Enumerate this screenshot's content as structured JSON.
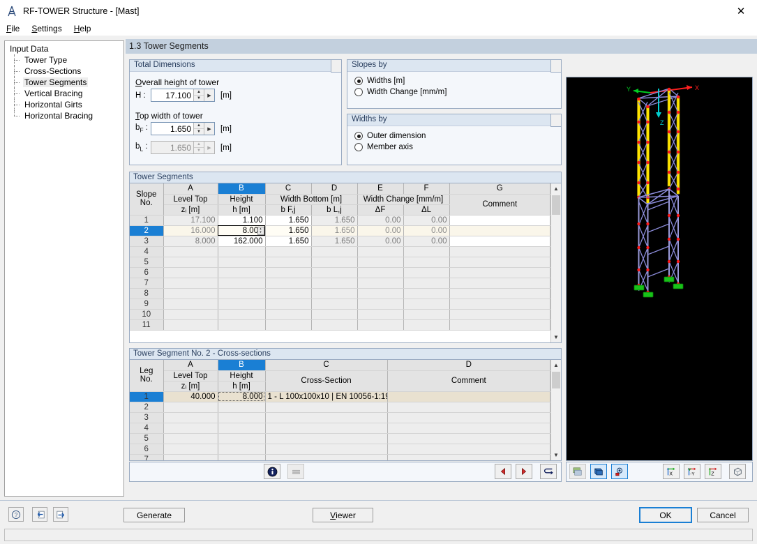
{
  "window": {
    "title": "RF-TOWER Structure - [Mast]",
    "app_icon": "tower-icon",
    "close_label": "✕"
  },
  "menu": [
    {
      "label": "File",
      "accel": "F"
    },
    {
      "label": "Settings",
      "accel": "S"
    },
    {
      "label": "Help",
      "accel": "H"
    }
  ],
  "sidebar": {
    "root": "Input Data",
    "items": [
      {
        "label": "Tower Type",
        "selected": false
      },
      {
        "label": "Cross-Sections",
        "selected": false
      },
      {
        "label": "Tower Segments",
        "selected": true
      },
      {
        "label": "Vertical Bracing",
        "selected": false
      },
      {
        "label": "Horizontal Girts",
        "selected": false
      },
      {
        "label": "Horizontal Bracing",
        "selected": false
      }
    ]
  },
  "page": {
    "title": "1.3 Tower Segments"
  },
  "total_dimensions": {
    "title": "Total Dimensions",
    "overall_height_label": "Overall height of tower",
    "overall_height_accel": "O",
    "h_symbol": "H :",
    "h_value": "17.100",
    "h_unit": "[m]",
    "top_width_label": "Top width of tower",
    "top_width_accel": "T",
    "bf_symbol": "b",
    "bf_sub": "F",
    "bf_value": "1.650",
    "bf_unit": "[m]",
    "bl_symbol": "b",
    "bl_sub": "L",
    "bl_value": "1.650",
    "bl_unit": "[m]"
  },
  "slopes_by": {
    "title": "Slopes by",
    "options": [
      {
        "label": "Widths [m]",
        "selected": true
      },
      {
        "label": "Width Change [mm/m]",
        "selected": false
      }
    ]
  },
  "widths_by": {
    "title": "Widths by",
    "options": [
      {
        "label": "Outer dimension",
        "selected": true
      },
      {
        "label": "Member axis",
        "selected": false
      }
    ]
  },
  "tower_segments": {
    "title": "Tower Segments",
    "column_letters": [
      "A",
      "B",
      "C",
      "D",
      "E",
      "F",
      "G"
    ],
    "selected_column": "B",
    "rowno_head_line1": "Slope",
    "rowno_head_line2": "No.",
    "headers_line1": {
      "A": "Level Top",
      "B": "Height",
      "CD": "Width Bottom [m]",
      "EF": "Width Change [mm/m]",
      "G": ""
    },
    "headers_line2": {
      "A": "zᵢ [m]",
      "B": "h [m]",
      "C": "b F,j",
      "D": "b L,j",
      "E": "ΔF",
      "F": "ΔL",
      "G": "Comment"
    },
    "rows": [
      {
        "no": "1",
        "A": "17.100",
        "B": "1.100",
        "C": "1.650",
        "D": "1.650",
        "E": "0.00",
        "F": "0.00",
        "G": "",
        "selected": false,
        "editing": false
      },
      {
        "no": "2",
        "A": "16.000",
        "B": "8.000",
        "C": "1.650",
        "D": "1.650",
        "E": "0.00",
        "F": "0.00",
        "G": "",
        "selected": true,
        "editing": true
      },
      {
        "no": "3",
        "A": "8.000",
        "B": "162.000",
        "C": "1.650",
        "D": "1.650",
        "E": "0.00",
        "F": "0.00",
        "G": "",
        "selected": false,
        "editing": false
      },
      {
        "no": "4",
        "A": "",
        "B": "",
        "C": "",
        "D": "",
        "E": "",
        "F": "",
        "G": "",
        "selected": false,
        "editing": false
      },
      {
        "no": "5",
        "A": "",
        "B": "",
        "C": "",
        "D": "",
        "E": "",
        "F": "",
        "G": "",
        "selected": false,
        "editing": false
      },
      {
        "no": "6",
        "A": "",
        "B": "",
        "C": "",
        "D": "",
        "E": "",
        "F": "",
        "G": "",
        "selected": false,
        "editing": false
      },
      {
        "no": "7",
        "A": "",
        "B": "",
        "C": "",
        "D": "",
        "E": "",
        "F": "",
        "G": "",
        "selected": false,
        "editing": false
      },
      {
        "no": "8",
        "A": "",
        "B": "",
        "C": "",
        "D": "",
        "E": "",
        "F": "",
        "G": "",
        "selected": false,
        "editing": false
      },
      {
        "no": "9",
        "A": "",
        "B": "",
        "C": "",
        "D": "",
        "E": "",
        "F": "",
        "G": "",
        "selected": false,
        "editing": false
      },
      {
        "no": "10",
        "A": "",
        "B": "",
        "C": "",
        "D": "",
        "E": "",
        "F": "",
        "G": "",
        "selected": false,
        "editing": false
      },
      {
        "no": "11",
        "A": "",
        "B": "",
        "C": "",
        "D": "",
        "E": "",
        "F": "",
        "G": "",
        "selected": false,
        "editing": false
      }
    ]
  },
  "cross_sections": {
    "title": "Tower Segment No. 2  -  Cross-sections",
    "column_letters": [
      "A",
      "B",
      "C",
      "D"
    ],
    "selected_column": "B",
    "rowno_head_line1": "Leg",
    "rowno_head_line2": "No.",
    "headers_line1": {
      "A": "Level Top",
      "B": "Height",
      "C": "",
      "D": ""
    },
    "headers_line2": {
      "A": "zᵢ [m]",
      "B": "h [m]",
      "C": "Cross-Section",
      "D": "Comment"
    },
    "rows": [
      {
        "no": "1",
        "A": "40.000",
        "B": "8.000",
        "C": "1 - L 100x100x10 | EN 10056-1:19",
        "D": "",
        "selected": true
      },
      {
        "no": "2",
        "A": "",
        "B": "",
        "C": "",
        "D": "",
        "selected": false
      },
      {
        "no": "3",
        "A": "",
        "B": "",
        "C": "",
        "D": "",
        "selected": false
      },
      {
        "no": "4",
        "A": "",
        "B": "",
        "C": "",
        "D": "",
        "selected": false
      },
      {
        "no": "5",
        "A": "",
        "B": "",
        "C": "",
        "D": "",
        "selected": false
      },
      {
        "no": "6",
        "A": "",
        "B": "",
        "C": "",
        "D": "",
        "selected": false
      },
      {
        "no": "7",
        "A": "",
        "B": "",
        "C": "",
        "D": "",
        "selected": false
      }
    ]
  },
  "table_toolbar": {
    "left": [
      {
        "icon": "info-icon",
        "enabled": true
      },
      {
        "icon": "equals-icon",
        "enabled": false
      }
    ],
    "right": [
      {
        "icon": "previous-arrow-icon"
      },
      {
        "icon": "next-arrow-icon"
      },
      {
        "icon": "pick-from-model-icon"
      }
    ]
  },
  "view_toolbar": {
    "render_group": [
      {
        "icon": "render-mode-icon",
        "active": false
      },
      {
        "icon": "solid-model-icon",
        "active": true
      },
      {
        "icon": "visibility-icon",
        "active": true
      }
    ],
    "axis_group": [
      {
        "icon": "view-x-icon",
        "label": "X"
      },
      {
        "icon": "view-y-icon",
        "label": "-Y"
      },
      {
        "icon": "view-z-icon",
        "label": "Z"
      },
      {
        "icon": "isometric-view-icon",
        "label": ""
      }
    ]
  },
  "viewer": {
    "axis_labels": {
      "x": "X",
      "y": "Y",
      "z": "Z"
    },
    "background": "#000000"
  },
  "bottom_bar": {
    "icons": [
      {
        "icon": "help-icon"
      },
      {
        "icon": "import-icon"
      },
      {
        "icon": "export-icon"
      }
    ],
    "generate_label": "Generate",
    "viewer_label": "Viewer",
    "viewer_accel": "V",
    "ok_label": "OK",
    "cancel_label": "Cancel"
  },
  "colors": {
    "accent": "#1a7fd4",
    "header_bar": "#c3d0de",
    "group_title": "#dce6f1",
    "grid_header": "#e3e3e3",
    "readonly_cell": "#ededed",
    "selected_row": "#e9e1d0"
  }
}
